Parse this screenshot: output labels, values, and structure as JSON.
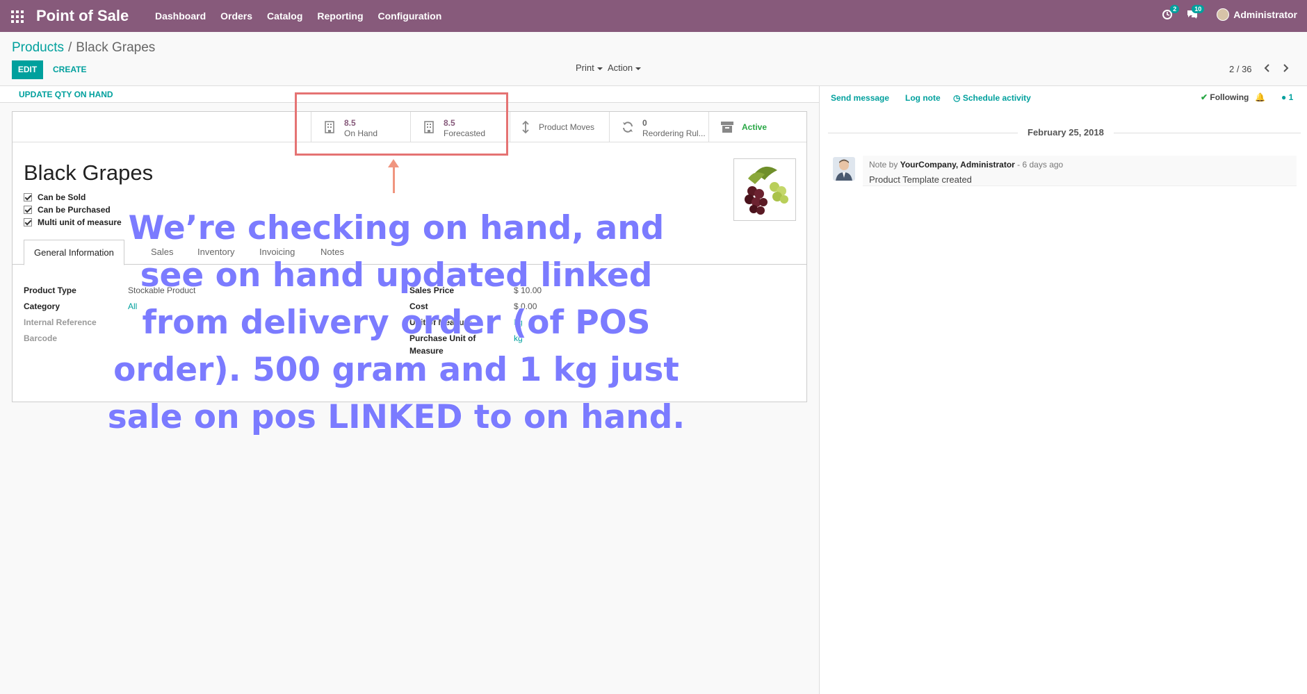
{
  "topbar": {
    "app_title": "Point of Sale",
    "menu": [
      "Dashboard",
      "Orders",
      "Catalog",
      "Reporting",
      "Configuration"
    ],
    "activity_badge": "2",
    "messages_badge": "10",
    "user": "Administrator"
  },
  "control": {
    "breadcrumb_parent": "Products",
    "breadcrumb_sep": "/",
    "breadcrumb_current": "Black Grapes",
    "edit_label": "EDIT",
    "create_label": "CREATE",
    "print_label": "Print",
    "action_label": "Action",
    "pager": "2 / 36"
  },
  "statusbar": {
    "update_qty": "UPDATE QTY ON HAND"
  },
  "smart_buttons": {
    "on_hand_value": "8.5",
    "on_hand_label": "On Hand",
    "forecasted_value": "8.5",
    "forecasted_label": "Forecasted",
    "moves_label": "Product Moves",
    "reorder_value": "0",
    "reorder_label": "Reordering Rul...",
    "active_label": "Active"
  },
  "product": {
    "name": "Black Grapes",
    "checkboxes": [
      "Can be Sold",
      "Can be Purchased",
      "Multi unit of measure"
    ]
  },
  "tabs": [
    "General Information",
    "Sales",
    "Inventory",
    "Invoicing",
    "Notes"
  ],
  "fields": {
    "product_type_label": "Product Type",
    "product_type": "Stockable Product",
    "category_label": "Category",
    "category": "All",
    "internal_ref_label": "Internal Reference",
    "barcode_label": "Barcode",
    "sales_price_label": "Sales Price",
    "sales_price": "$ 10.00",
    "cost_label": "Cost",
    "cost": "$ 0.00",
    "uom_label": "Unit of Measure",
    "uom": "kg",
    "purchase_uom_label_1": "Purchase Unit of",
    "purchase_uom_label_2": "Measure",
    "purchase_uom": "kg"
  },
  "annotation": {
    "text": "We’re checking on hand, and see on hand updated linked from delivery order (of POS order). 500 gram and 1 kg just sale on pos LINKED to on hand."
  },
  "chatter": {
    "send_message": "Send message",
    "log_note": "Log note",
    "schedule_activity": "Schedule activity",
    "following": "Following",
    "followers_count": "1",
    "date": "February 25, 2018",
    "note_prefix": "Note by",
    "note_author": "YourCompany, Administrator",
    "note_time": "- 6 days ago",
    "note_body": "Product Template created"
  },
  "colors": {
    "brand": "#875a7b",
    "accent": "#00a09d",
    "annotation": "#7b7bff",
    "highlight": "#e57373",
    "arrow": "#f0957f"
  }
}
